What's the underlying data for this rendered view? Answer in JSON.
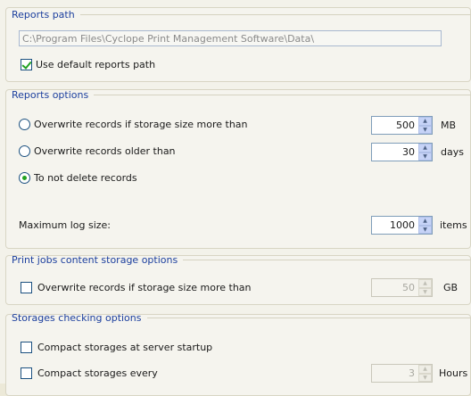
{
  "reports_path": {
    "title": "Reports path",
    "path_value": "C:\\Program Files\\Cyclope Print Management Software\\Data\\",
    "use_default_label": "Use default reports path"
  },
  "reports_options": {
    "title": "Reports options",
    "overwrite_size_label": "Overwrite records if storage size more than",
    "overwrite_size_value": "500",
    "overwrite_size_unit": "MB",
    "overwrite_older_label": "Overwrite records older than",
    "overwrite_older_value": "30",
    "overwrite_older_unit": "days",
    "no_delete_label": "To not delete records",
    "max_log_label": "Maximum log size:",
    "max_log_value": "1000",
    "max_log_unit": "items"
  },
  "print_jobs": {
    "title": "Print jobs content storage options",
    "overwrite_label": "Overwrite records if storage size more than",
    "overwrite_value": "50",
    "overwrite_unit": "GB"
  },
  "storages_checking": {
    "title": "Storages checking options",
    "compact_startup_label": "Compact storages at server startup",
    "compact_every_label": "Compact storages every",
    "compact_every_value": "3",
    "compact_every_unit": "Hours"
  }
}
